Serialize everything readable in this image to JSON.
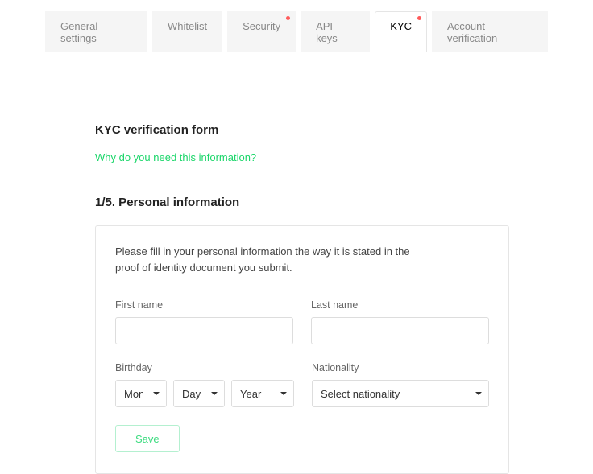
{
  "tabs": {
    "general": "General settings",
    "whitelist": "Whitelist",
    "security": "Security",
    "apikeys": "API keys",
    "kyc": "KYC",
    "account": "Account verification"
  },
  "page": {
    "title": "KYC verification form",
    "info_link": "Why do you need this information?",
    "section_title": "1/5. Personal information"
  },
  "form": {
    "instruction": "Please fill in your personal information the way it is stated in the proof of identity document you submit.",
    "first_name_label": "First name",
    "last_name_label": "Last name",
    "birthday_label": "Birthday",
    "nationality_label": "Nationality",
    "month_placeholder": "Month",
    "day_placeholder": "Day",
    "year_placeholder": "Year",
    "nationality_placeholder": "Select nationality",
    "save_label": "Save"
  }
}
